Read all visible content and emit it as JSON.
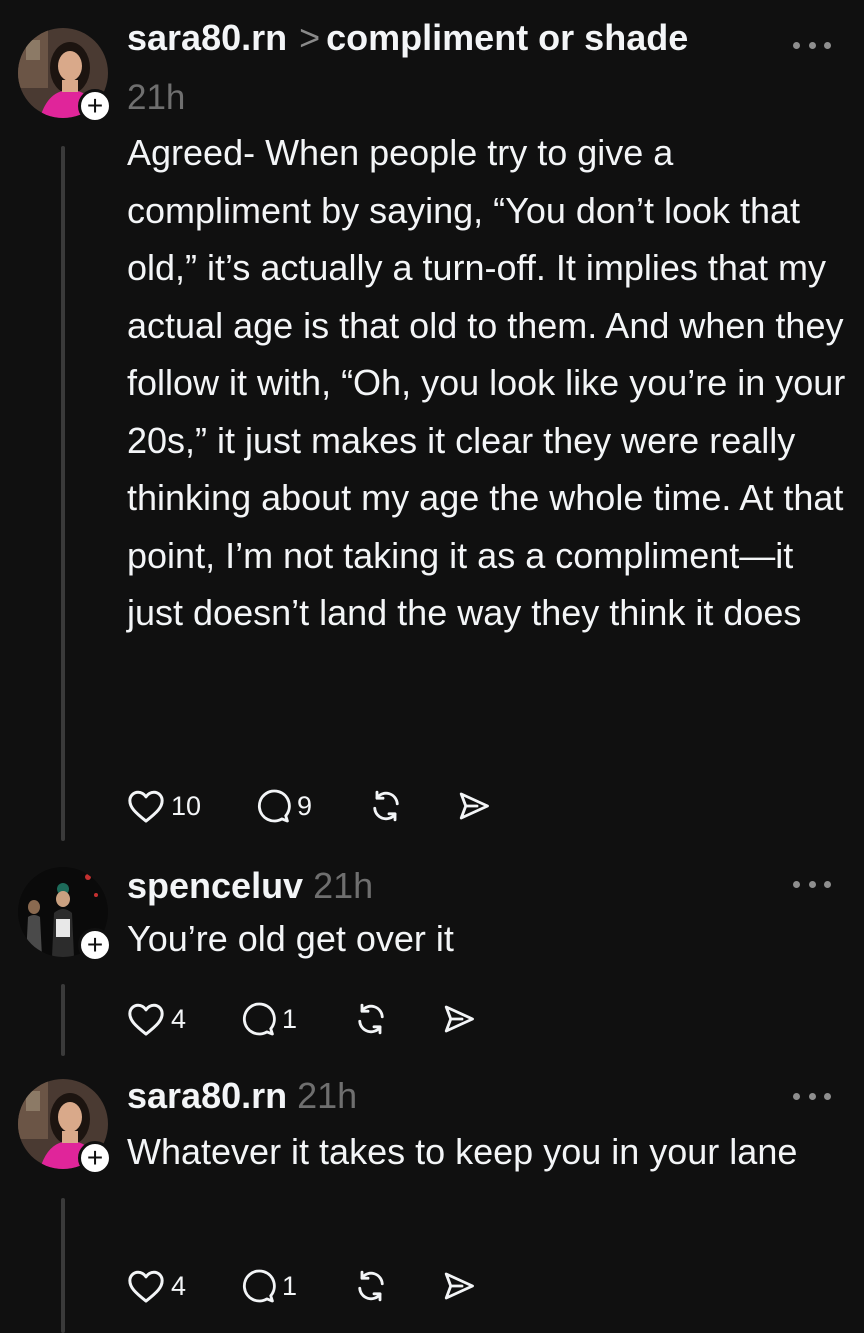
{
  "posts": [
    {
      "username": "sara80.rn",
      "chevron": ">",
      "topic": "compliment or shade",
      "time": "21h",
      "text": "Agreed-  When people try to give a compliment by saying, “You don’t look that old,” it’s actually a turn-off. It implies that my actual age is that old to them. And when they follow it with, “Oh, you look like you’re in your 20s,” it just makes it clear they were really thinking about my age the whole time. At that point, I’m not taking it as a compliment—it just doesn’t land the way they think it does",
      "likes": "10",
      "replies": "9"
    },
    {
      "username": "spenceluv",
      "time": "21h",
      "text": "You’re old get over it",
      "likes": "4",
      "replies": "1"
    },
    {
      "username": "sara80.rn",
      "time": "21h",
      "text": "Whatever it takes to keep you in your lane",
      "likes": "4",
      "replies": "1"
    }
  ],
  "icons": {
    "like": "heart-icon",
    "reply": "comment-icon",
    "repost": "repost-icon",
    "share": "share-icon",
    "more": "more-icon",
    "follow": "plus-icon"
  },
  "colors": {
    "background": "#101010",
    "text": "#f3f5f7",
    "muted": "#6f6f6f",
    "thread_line": "#3a3a3a"
  },
  "follow_badge": "+"
}
